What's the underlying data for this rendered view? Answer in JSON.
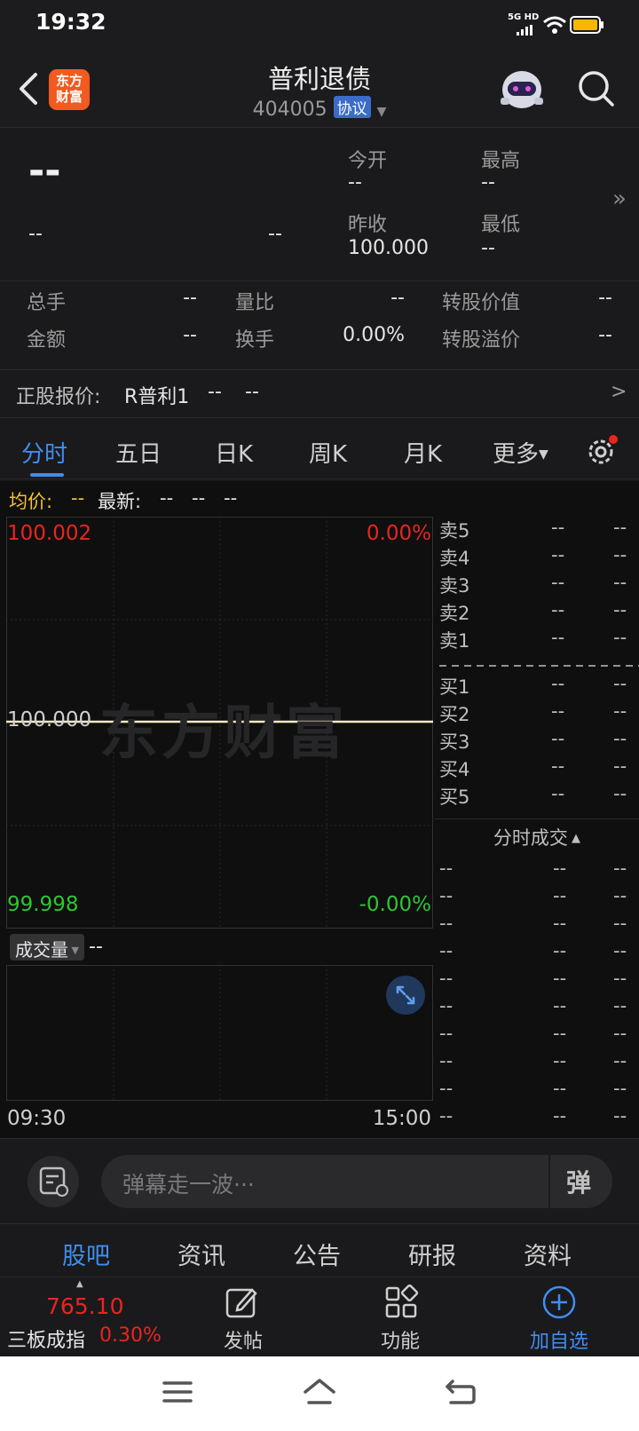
{
  "status": {
    "time": "19:32",
    "network": "5G HD"
  },
  "header": {
    "logo_text_line1": "东方",
    "logo_text_line2": "财富",
    "title": "普利退债",
    "code": "404005",
    "tag": "协议"
  },
  "quote": {
    "price": "--",
    "change": "--",
    "change_pct": "--",
    "open_label": "今开",
    "open_value": "--",
    "high_label": "最高",
    "high_value": "--",
    "prev_close_label": "昨收",
    "prev_close_value": "100.000",
    "low_label": "最低",
    "low_value": "--"
  },
  "stats": {
    "volume_label": "总手",
    "volume_value": "--",
    "vol_ratio_label": "量比",
    "vol_ratio_value": "--",
    "conv_value_label": "转股价值",
    "conv_value_value": "--",
    "amount_label": "金额",
    "amount_value": "--",
    "turnover_label": "换手",
    "turnover_value": "0.00%",
    "conv_premium_label": "转股溢价",
    "conv_premium_value": "--"
  },
  "stock_link": {
    "label": "正股报价:",
    "name": "R普利1",
    "price": "--",
    "change": "--",
    "arrow": ">"
  },
  "tabs": [
    "分时",
    "五日",
    "日K",
    "周K",
    "月K",
    "更多"
  ],
  "avg_row": {
    "avg_label": "均价:",
    "avg_value": "--",
    "latest_label": "最新:",
    "latest_v1": "--",
    "latest_v2": "--",
    "latest_v3": "--"
  },
  "chart": {
    "top_price": "100.002",
    "top_pct": "0.00%",
    "mid_price": "100.000",
    "bottom_price": "99.998",
    "bottom_pct": "-0.00%",
    "watermark": "东方财富",
    "volume_label": "成交量",
    "volume_value": "--",
    "time_start": "09:30",
    "time_end": "15:00",
    "colors": {
      "up": "#e8251f",
      "down": "#2fc530",
      "price_line": "#f2e9c8",
      "accent": "#3f8ef0"
    }
  },
  "orderbook": {
    "sell": [
      {
        "label": "卖5",
        "price": "--",
        "volume": "--"
      },
      {
        "label": "卖4",
        "price": "--",
        "volume": "--"
      },
      {
        "label": "卖3",
        "price": "--",
        "volume": "--"
      },
      {
        "label": "卖2",
        "price": "--",
        "volume": "--"
      },
      {
        "label": "卖1",
        "price": "--",
        "volume": "--"
      }
    ],
    "buy": [
      {
        "label": "买1",
        "price": "--",
        "volume": "--"
      },
      {
        "label": "买2",
        "price": "--",
        "volume": "--"
      },
      {
        "label": "买3",
        "price": "--",
        "volume": "--"
      },
      {
        "label": "买4",
        "price": "--",
        "volume": "--"
      },
      {
        "label": "买5",
        "price": "--",
        "volume": "--"
      }
    ],
    "ticks_title": "分时成交",
    "ticks": [
      {
        "time": "--",
        "price": "--",
        "volume": "--"
      },
      {
        "time": "--",
        "price": "--",
        "volume": "--"
      },
      {
        "time": "--",
        "price": "--",
        "volume": "--"
      },
      {
        "time": "--",
        "price": "--",
        "volume": "--"
      },
      {
        "time": "--",
        "price": "--",
        "volume": "--"
      },
      {
        "time": "--",
        "price": "--",
        "volume": "--"
      },
      {
        "time": "--",
        "price": "--",
        "volume": "--"
      },
      {
        "time": "--",
        "price": "--",
        "volume": "--"
      },
      {
        "time": "--",
        "price": "--",
        "volume": "--"
      },
      {
        "time": "--",
        "price": "--",
        "volume": "--"
      }
    ]
  },
  "comment": {
    "placeholder": "弹幕走一波···",
    "danmu_label": "弹"
  },
  "bottom_tabs": [
    "股吧",
    "资讯",
    "公告",
    "研报",
    "资料"
  ],
  "index": {
    "value": "765.10",
    "name": "三板成指",
    "pct": "0.30%"
  },
  "actions": {
    "post": "发帖",
    "function": "功能",
    "add": "加自选"
  }
}
